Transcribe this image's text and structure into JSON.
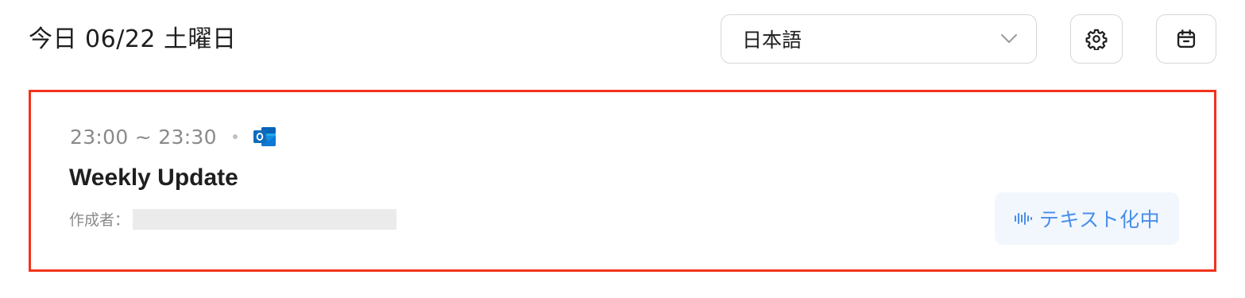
{
  "header": {
    "date_label": "今日 06/22 土曜日",
    "language_select": {
      "selected": "日本語"
    },
    "settings_icon": "gear-icon",
    "calendar_icon": "calendar-icon"
  },
  "meeting": {
    "time_range": "23:00 ~ 23:30",
    "source_icon": "outlook-icon",
    "title": "Weekly Update",
    "creator_label": "作成者：",
    "status": "テキスト化中",
    "status_icon": "audio-wave-icon"
  },
  "colors": {
    "highlight_border": "#f2331c",
    "status_text": "#4a8ee8",
    "status_bg": "#f2f7fe",
    "outlook_blue": "#0f6cbd"
  }
}
